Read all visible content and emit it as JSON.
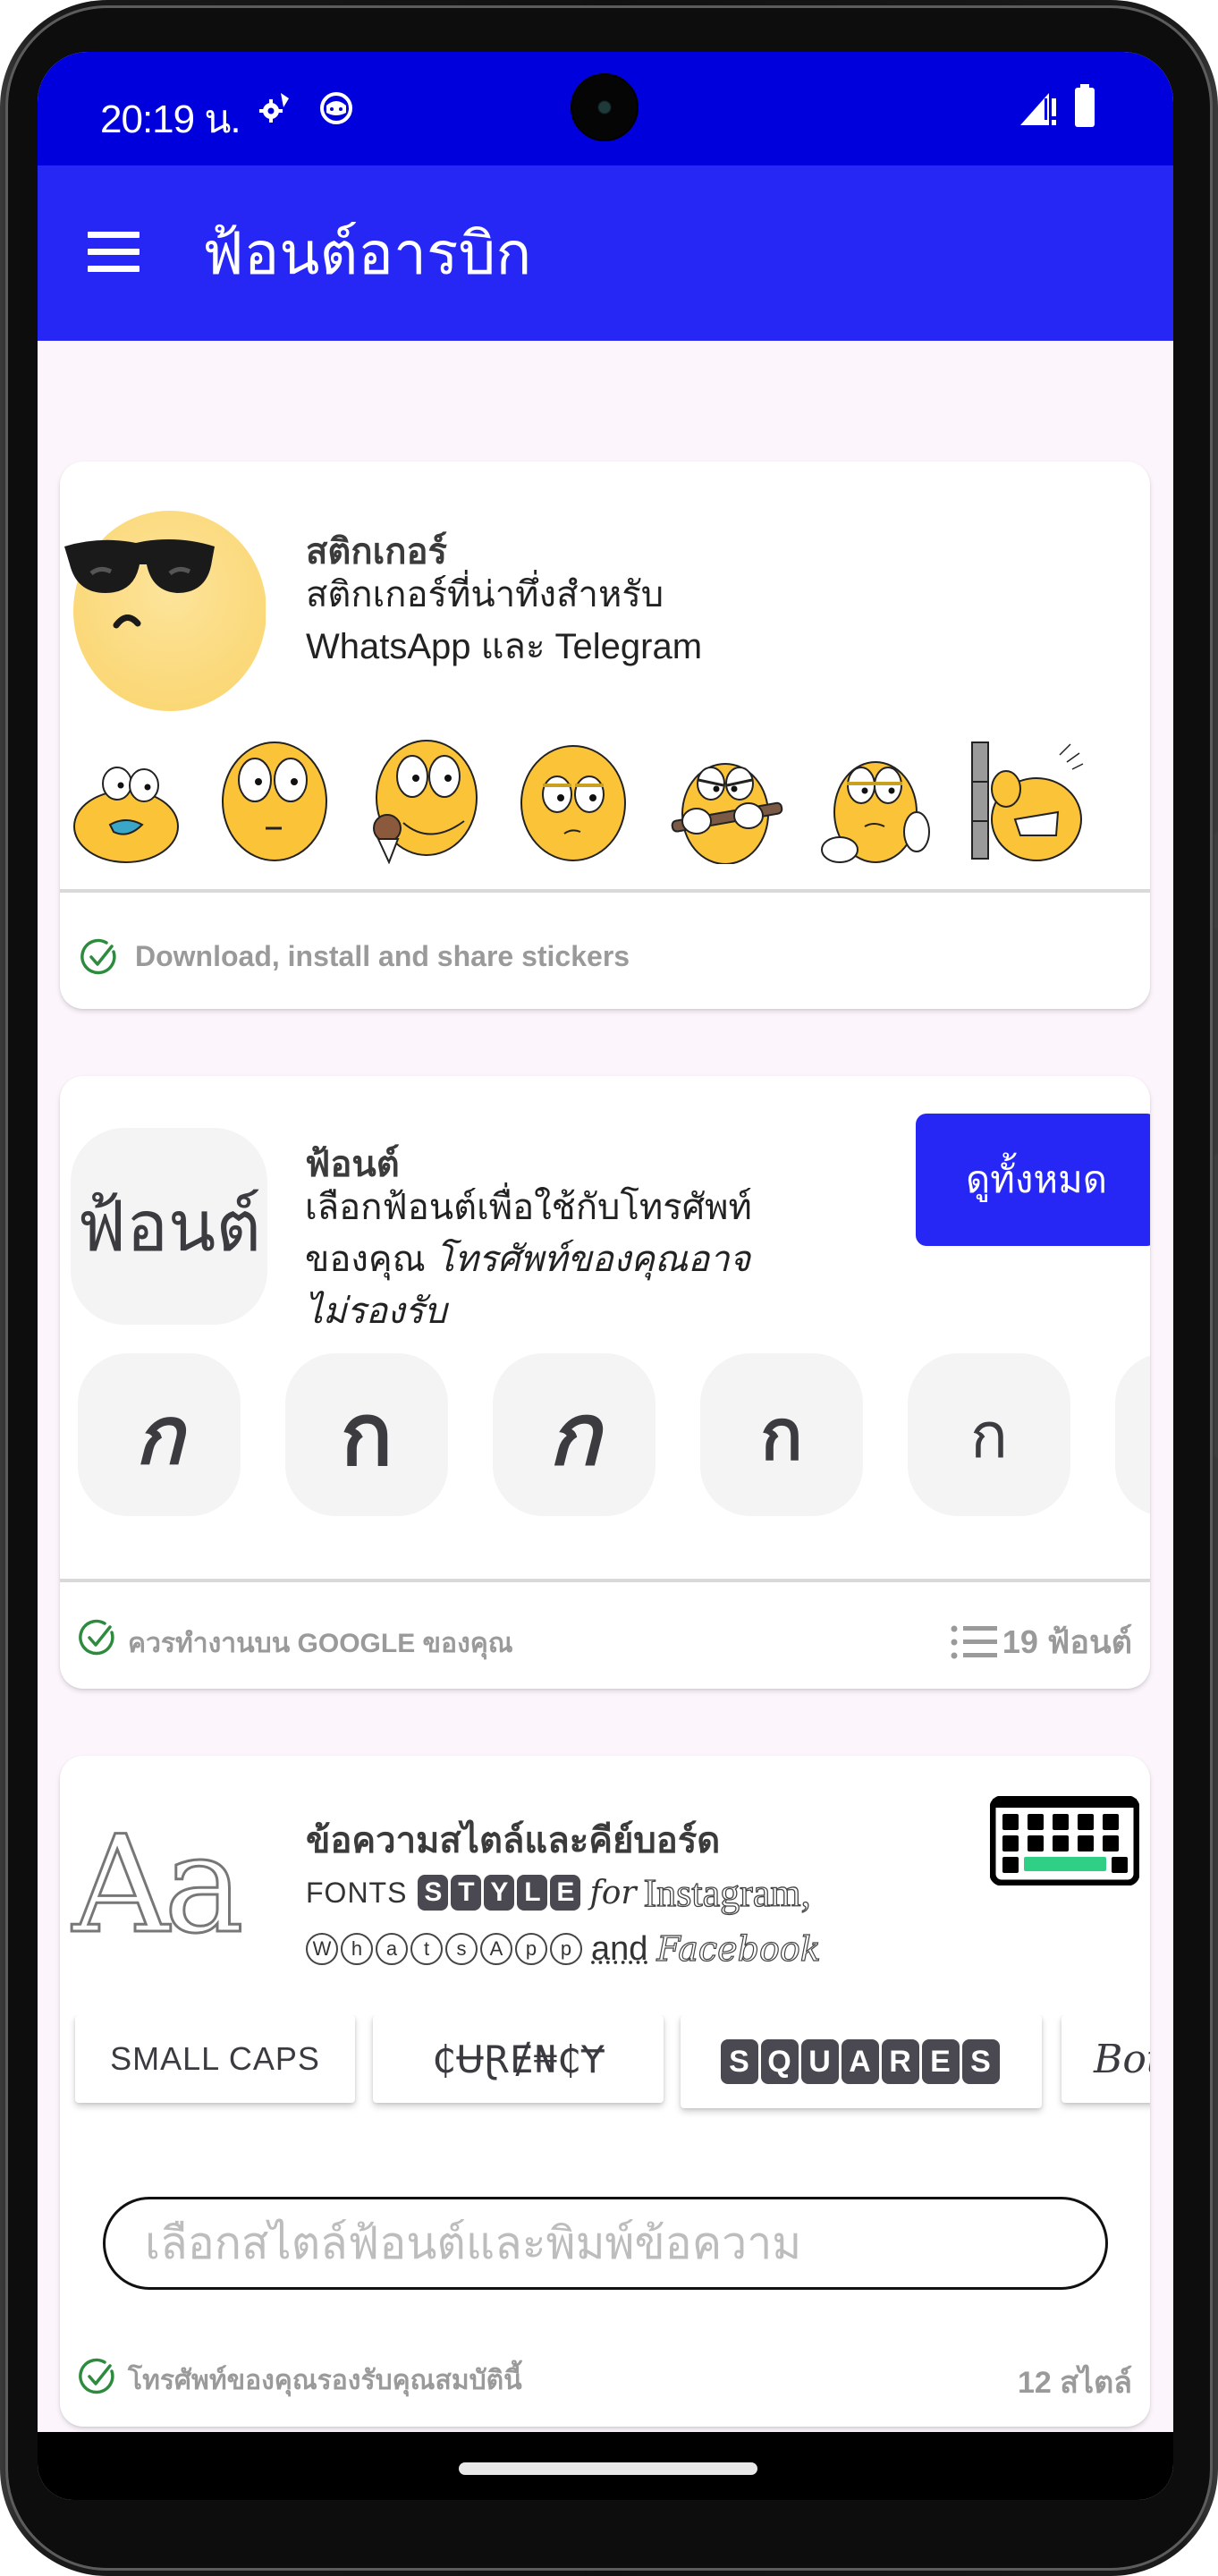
{
  "status_bar": {
    "time": "20:19 น.",
    "left_icons": [
      "settings-gear-icon",
      "cat-face-icon"
    ],
    "right_icons": [
      "signal-no-data-icon",
      "battery-icon"
    ]
  },
  "app_bar": {
    "menu_icon": "hamburger-menu-icon",
    "title": "ฟ้อนต์อารบิก",
    "color": "#2626f5"
  },
  "colors": {
    "status_bar": "#0000dd",
    "accent": "#2626f5",
    "check_green": "#2e8b3e",
    "background": "#fcf6fc"
  },
  "cards": {
    "stickers": {
      "title": "สติกเกอร์",
      "desc_line1": "สติกเกอร์ที่น่าทึ่งสำหรับ",
      "desc_line2": "WhatsApp และ Telegram",
      "hero_icon": "sunglasses-emoji-sticker",
      "stickers": [
        "tongue-out-emoji-sticker",
        "wide-eyed-emoji-sticker",
        "ice-cream-emoji-sticker",
        "unimpressed-emoji-sticker",
        "bat-holding-emoji-sticker",
        "fist-emoji-sticker",
        "head-bang-wall-emoji-sticker"
      ],
      "footer": "Download, install and share stickers"
    },
    "fonts": {
      "title": "ฟ้อนต์",
      "thumbnail_text": "ฟ้อนต์",
      "desc_line1": "เลือกฟ้อนต์เพื่อใช้กับโทรศัพท์",
      "desc_line2_normal": "ของคุณ ",
      "desc_line2_italic": "โทรศัพท์ของคุณอาจ",
      "desc_line3_italic": "ไม่รองรับ",
      "view_all_label": "ดูทั้งหมด",
      "glyphs": [
        "ก",
        "ก",
        "ก",
        "ก",
        "ก"
      ],
      "footer": "ควรทำงานบน GOOGLE ของคุณ",
      "count_label": "19 ฟ้อนต์"
    },
    "styled_text": {
      "title": "ข้อความสไตล์และคีย์บอร์ด",
      "logo_text": "Aa",
      "line1_fonts": "FONTS",
      "line1_style_letters": [
        "S",
        "T",
        "Y",
        "L",
        "E"
      ],
      "line1_for": "for",
      "line1_instagram": "Instagram,",
      "line2_circled_letters": [
        "W",
        "h",
        "a",
        "t",
        "s",
        "A",
        "p",
        "p"
      ],
      "line2_and": "and",
      "line2_facebook": "Facebook",
      "style_chips": [
        {
          "label": "SMALL CAPS"
        },
        {
          "label": "₵ɄⱤɆ₦₵Ɏ"
        },
        {
          "label_letters": [
            "S",
            "Q",
            "U",
            "A",
            "R",
            "E",
            "S"
          ]
        },
        {
          "label": "Bot"
        }
      ],
      "input_placeholder": "เลือกสไตล์ฟ้อนต์และพิมพ์ข้อความ",
      "input_value": "",
      "footer": "โทรศัพท์ของคุณรองรับคุณสมบัตินี้",
      "count_label": "12 สไตล์"
    }
  }
}
